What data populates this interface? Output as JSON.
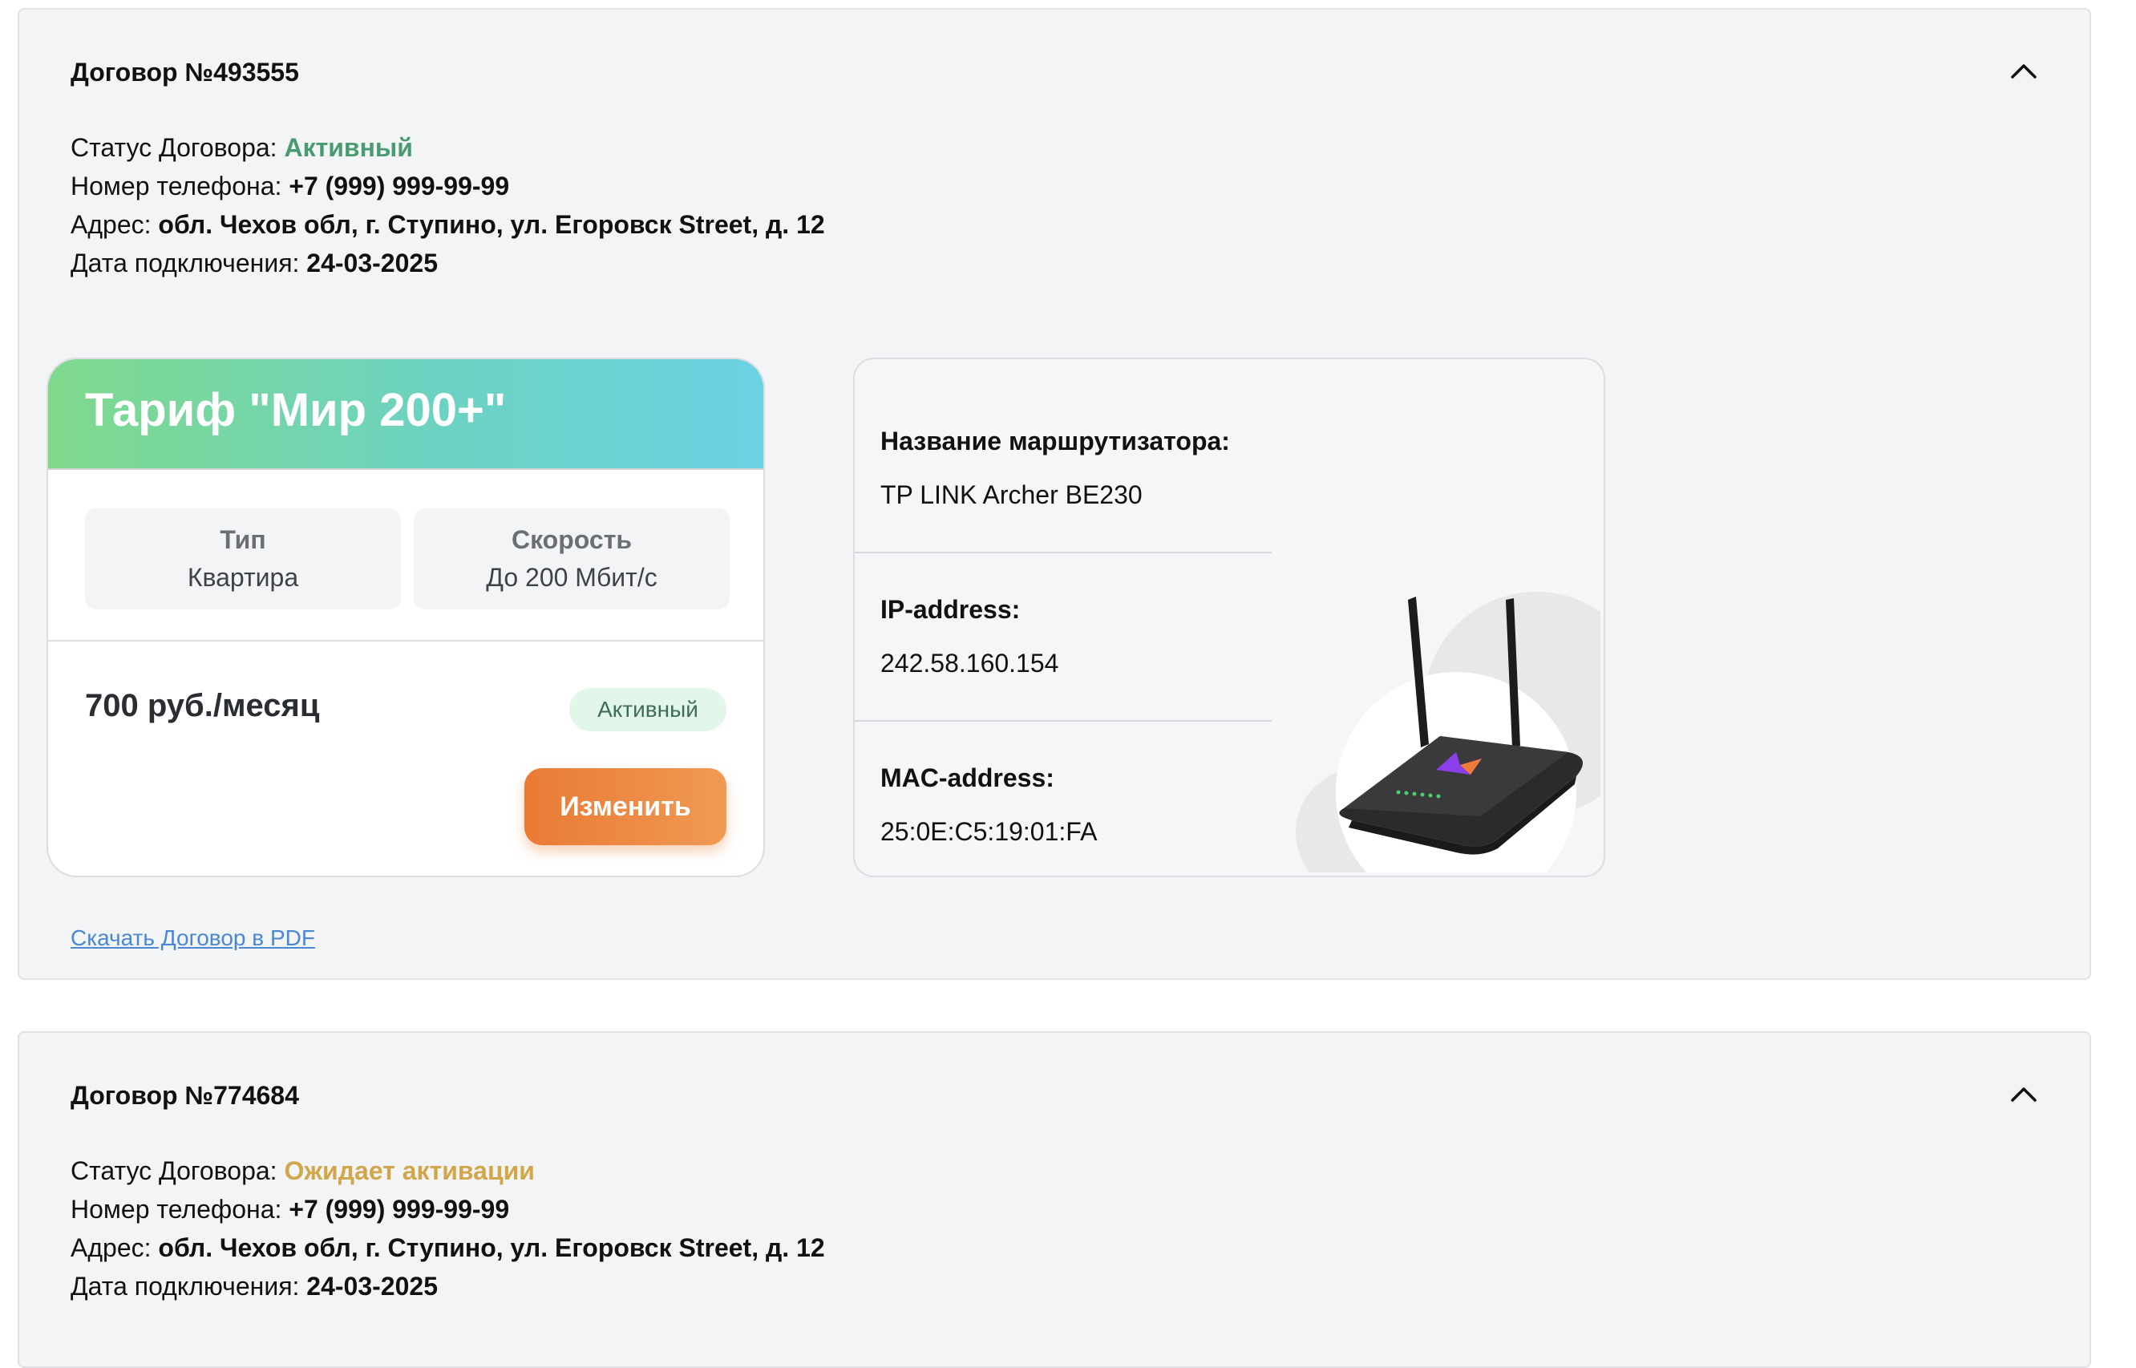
{
  "contracts": [
    {
      "title": "Договор №493555",
      "status_label": "Статус Договора:",
      "status_value": "Активный",
      "phone_label": "Номер телефона:",
      "phone_value": "+7 (999) 999-99-99",
      "address_label": "Адрес:",
      "address_value": "обл. Чехов обл, г. Ступино, ул. Егоровск Street, д. 12",
      "date_label": "Дата подключения:",
      "date_value": "24-03-2025",
      "tariff": {
        "name": "Тариф \"Мир 200+\"",
        "type_label": "Тип",
        "type_value": "Квартира",
        "speed_label": "Скорость",
        "speed_value": "До 200 Мбит/с",
        "price": "700 руб./месяц",
        "status_badge": "Активный",
        "change_button": "Изменить"
      },
      "router": {
        "name_label": "Название маршрутизатора:",
        "name_value": "TP LINK Archer BE230",
        "ip_label": "IP-address:",
        "ip_value": "242.58.160.154",
        "mac_label": "MAC-address:",
        "mac_value": "25:0E:C5:19:01:FA"
      },
      "pdf_link": "Скачать Договор в PDF"
    },
    {
      "title": "Договор №774684",
      "status_label": "Статус Договора:",
      "status_value": "Ожидает активации",
      "phone_label": "Номер телефона:",
      "phone_value": "+7 (999) 999-99-99",
      "address_label": "Адрес:",
      "address_value": "обл. Чехов обл, г. Ступино, ул. Егоровск Street, д. 12",
      "date_label": "Дата подключения:",
      "date_value": "24-03-2025"
    }
  ],
  "icons": {
    "collapse": "chevron-up-icon",
    "router": "router-image"
  },
  "colors": {
    "status_active": "#4a9b71",
    "status_pending": "#d2a64a",
    "button_orange": "#e97a34",
    "link_blue": "#4a88d6",
    "card_bg": "#f3f4f6"
  }
}
